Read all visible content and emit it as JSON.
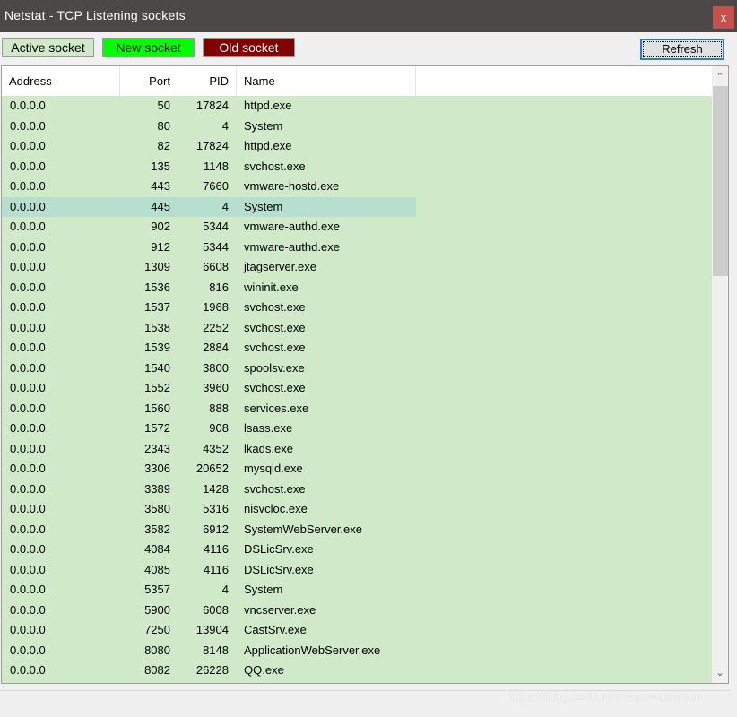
{
  "window": {
    "title": "Netstat - TCP Listening sockets",
    "close": "x"
  },
  "legend": {
    "active": "Active socket",
    "new": "New socket",
    "old": "Old socket"
  },
  "colors": {
    "active": "#cfe9c9",
    "new": "#00ff00",
    "old": "#800000",
    "selected": "#b6dfcf"
  },
  "toolbar": {
    "refresh": "Refresh"
  },
  "table": {
    "columns": [
      "Address",
      "Port",
      "PID",
      "Name"
    ],
    "selected_index": 5,
    "rows": [
      [
        "0.0.0.0",
        "50",
        "17824",
        "httpd.exe"
      ],
      [
        "0.0.0.0",
        "80",
        "4",
        "System"
      ],
      [
        "0.0.0.0",
        "82",
        "17824",
        "httpd.exe"
      ],
      [
        "0.0.0.0",
        "135",
        "1148",
        "svchost.exe"
      ],
      [
        "0.0.0.0",
        "443",
        "7660",
        "vmware-hostd.exe"
      ],
      [
        "0.0.0.0",
        "445",
        "4",
        "System"
      ],
      [
        "0.0.0.0",
        "902",
        "5344",
        "vmware-authd.exe"
      ],
      [
        "0.0.0.0",
        "912",
        "5344",
        "vmware-authd.exe"
      ],
      [
        "0.0.0.0",
        "1309",
        "6608",
        "jtagserver.exe"
      ],
      [
        "0.0.0.0",
        "1536",
        "816",
        "wininit.exe"
      ],
      [
        "0.0.0.0",
        "1537",
        "1968",
        "svchost.exe"
      ],
      [
        "0.0.0.0",
        "1538",
        "2252",
        "svchost.exe"
      ],
      [
        "0.0.0.0",
        "1539",
        "2884",
        "svchost.exe"
      ],
      [
        "0.0.0.0",
        "1540",
        "3800",
        "spoolsv.exe"
      ],
      [
        "0.0.0.0",
        "1552",
        "3960",
        "svchost.exe"
      ],
      [
        "0.0.0.0",
        "1560",
        "888",
        "services.exe"
      ],
      [
        "0.0.0.0",
        "1572",
        "908",
        "lsass.exe"
      ],
      [
        "0.0.0.0",
        "2343",
        "4352",
        "lkads.exe"
      ],
      [
        "0.0.0.0",
        "3306",
        "20652",
        "mysqld.exe"
      ],
      [
        "0.0.0.0",
        "3389",
        "1428",
        "svchost.exe"
      ],
      [
        "0.0.0.0",
        "3580",
        "5316",
        "nisvcloc.exe"
      ],
      [
        "0.0.0.0",
        "3582",
        "6912",
        "SystemWebServer.exe"
      ],
      [
        "0.0.0.0",
        "4084",
        "4116",
        "DSLicSrv.exe"
      ],
      [
        "0.0.0.0",
        "4085",
        "4116",
        "DSLicSrv.exe"
      ],
      [
        "0.0.0.0",
        "5357",
        "4",
        "System"
      ],
      [
        "0.0.0.0",
        "5900",
        "6008",
        "vncserver.exe"
      ],
      [
        "0.0.0.0",
        "7250",
        "13904",
        "CastSrv.exe"
      ],
      [
        "0.0.0.0",
        "8080",
        "8148",
        "ApplicationWebServer.exe"
      ],
      [
        "0.0.0.0",
        "8082",
        "26228",
        "QQ.exe"
      ]
    ]
  },
  "watermark": "https://blog.csdn.net/zhanwaifeixue"
}
